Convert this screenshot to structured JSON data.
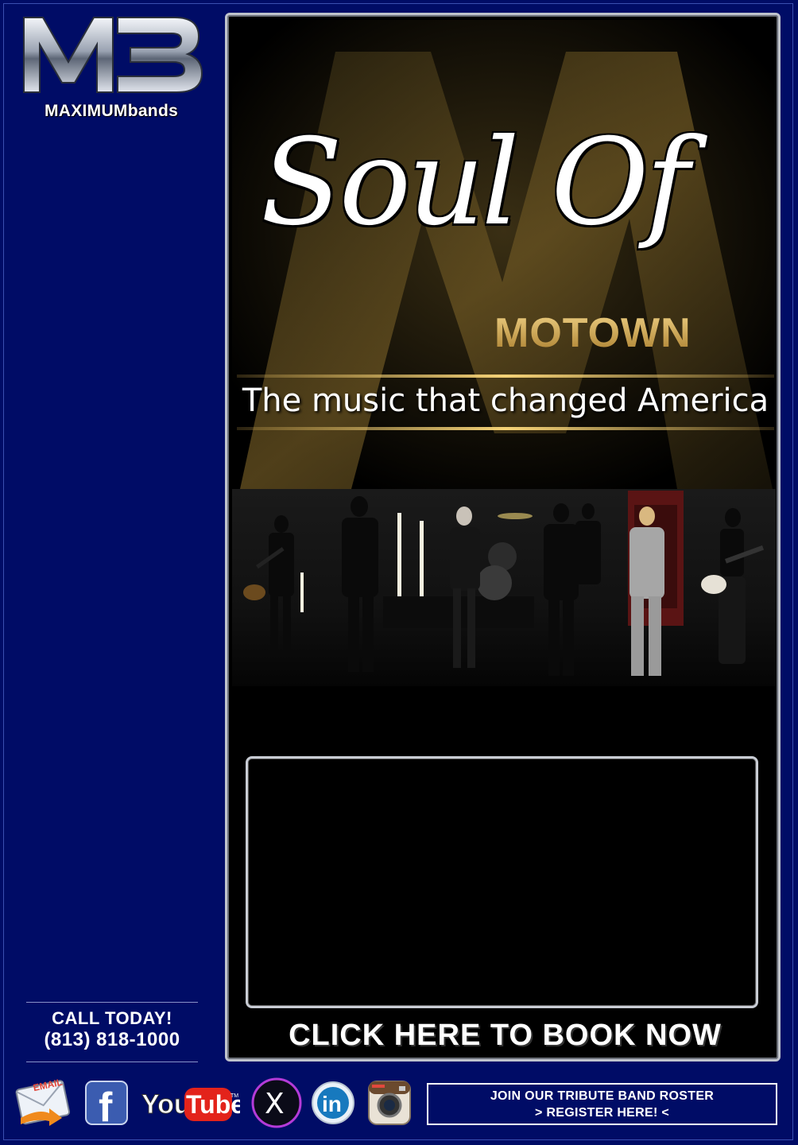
{
  "brand": {
    "monogram": "MB",
    "name": "MAXIMUMbands"
  },
  "hero": {
    "script_title": "Soul Of",
    "subtitle": "MOTOWN",
    "tagline": "The music that changed America"
  },
  "cta": {
    "book_now": "CLICK HERE TO BOOK NOW"
  },
  "contact": {
    "call_label": "CALL TODAY!",
    "phone": "(813) 818-1000"
  },
  "social": {
    "email_label": "EMAIL",
    "youtube_you": "You",
    "youtube_tube": "Tube",
    "youtube_tm": "TM",
    "x_label": "X",
    "linkedin_label": "in",
    "facebook_label": "f"
  },
  "register": {
    "line1": "JOIN OUR TRIBUTE BAND ROSTER",
    "line2": "> REGISTER HERE! <"
  },
  "colors": {
    "page_bg": "#000c66",
    "gold": "#d8b25b",
    "panel_border": "#bfc3cc"
  }
}
